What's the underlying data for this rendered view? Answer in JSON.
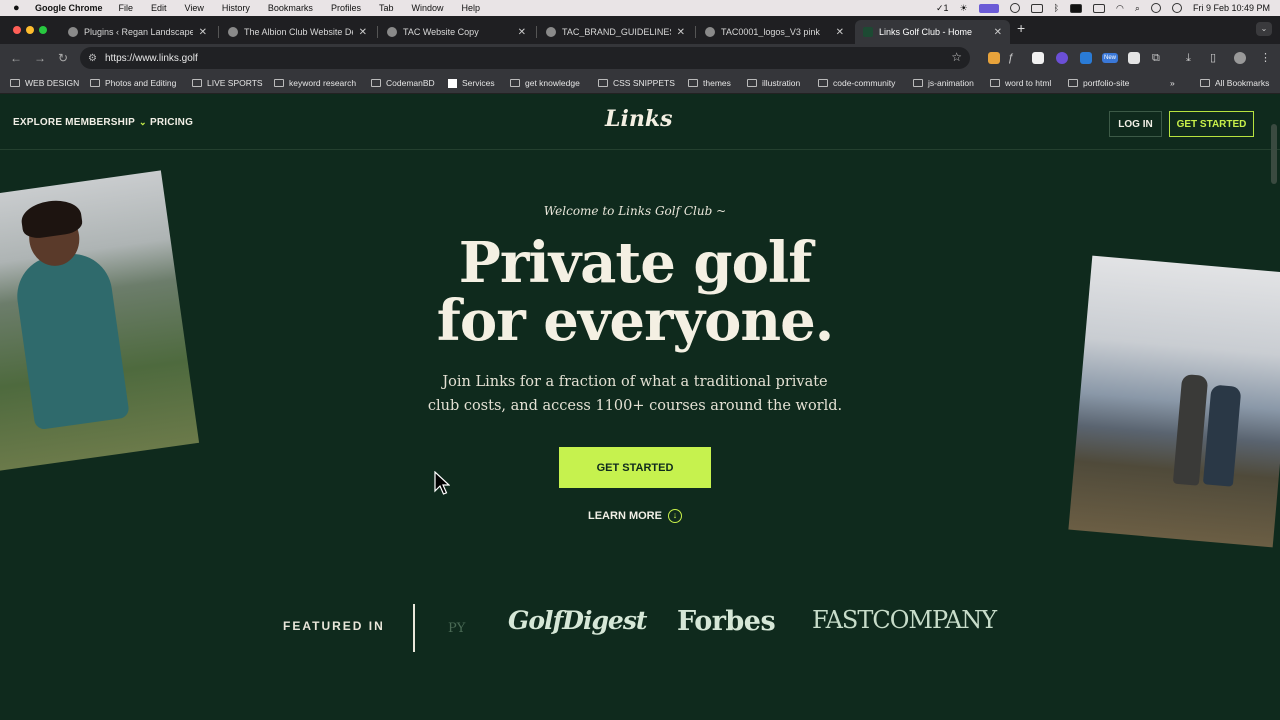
{
  "menubar": {
    "app": "Google Chrome",
    "items": [
      "File",
      "Edit",
      "View",
      "History",
      "Bookmarks",
      "Profiles",
      "Tab",
      "Window",
      "Help"
    ],
    "datetime": "Fri 9 Feb  10:49 PM",
    "badge": "1"
  },
  "tabs": [
    {
      "title": "Plugins ‹ Regan Landscape –",
      "active": false
    },
    {
      "title": "The Albion Club Website Des",
      "active": false
    },
    {
      "title": "TAC Website Copy",
      "active": false
    },
    {
      "title": "TAC_BRAND_GUIDELINES_V",
      "active": false
    },
    {
      "title": "TAC0001_logos_V3 pink",
      "active": false
    },
    {
      "title": "Links Golf Club - Home",
      "active": true
    }
  ],
  "toolbar": {
    "url": "https://www.links.golf",
    "ext_badge": "New"
  },
  "bookmarks": [
    "WEB DESIGN",
    "Photos and Editing",
    "LIVE SPORTS",
    "keyword research",
    "CodemanBD",
    "Services",
    "get knowledge",
    "CSS SNIPPETS",
    "themes",
    "illustration",
    "code-community",
    "js-animation",
    "word to html",
    "portfolio-site"
  ],
  "bookmarks_all": "All Bookmarks",
  "site": {
    "nav": {
      "explore": "EXPLORE MEMBERSHIP",
      "pricing": "PRICING",
      "logo": "Links",
      "login": "LOG IN",
      "get_started": "GET STARTED"
    },
    "hero": {
      "welcome": "Welcome to Links Golf Club ~",
      "headline_line1": "Private golf",
      "headline_line2": "for everyone.",
      "subhead": "Join Links for a fraction of what a traditional private club costs, and access 1100+ courses around the world.",
      "cta": "GET STARTED",
      "learn_more": "LEARN MORE"
    },
    "featured": {
      "label": "FEATURED IN",
      "partial": "PY",
      "publications": [
        "GolfDigest",
        "Forbes",
        "FASTCOMPANY"
      ]
    }
  },
  "colors": {
    "page_bg": "#0f2a1d",
    "accent": "#c6f24e",
    "text": "#f4f0e3"
  }
}
